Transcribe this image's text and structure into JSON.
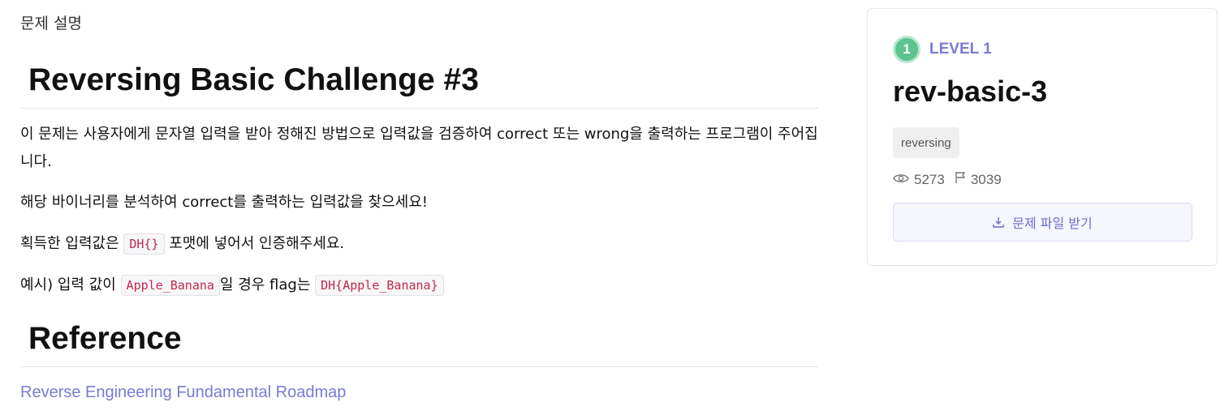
{
  "section_label": "문제 설명",
  "title": "Reversing Basic Challenge #3",
  "description": {
    "p1": "이 문제는 사용자에게 문자열 입력을 받아 정해진 방법으로 입력값을 검증하여 correct 또는 wrong을 출력하는 프로그램이 주어집니다.",
    "p2": "해당 바이너리를 분석하여 correct를 출력하는 입력값을 찾으세요!",
    "p3_before": "획득한 입력값은 ",
    "p3_code": "DH{}",
    "p3_after": " 포맷에 넣어서 인증해주세요.",
    "p4_before": "예시) 입력 값이 ",
    "p4_code1": "Apple_Banana",
    "p4_middle": "일 경우 flag는 ",
    "p4_code2": "DH{Apple_Banana}"
  },
  "reference": {
    "heading": "Reference",
    "link_text": "Reverse Engineering Fundamental Roadmap"
  },
  "card": {
    "level_number": "1",
    "level_text": "LEVEL 1",
    "challenge_name": "rev-basic-3",
    "tag": "reversing",
    "views": "5273",
    "solves": "3039",
    "download_label": "문제 파일 받기",
    "accent_color": "#7a7ad6",
    "level_color": "#5cc48e"
  }
}
